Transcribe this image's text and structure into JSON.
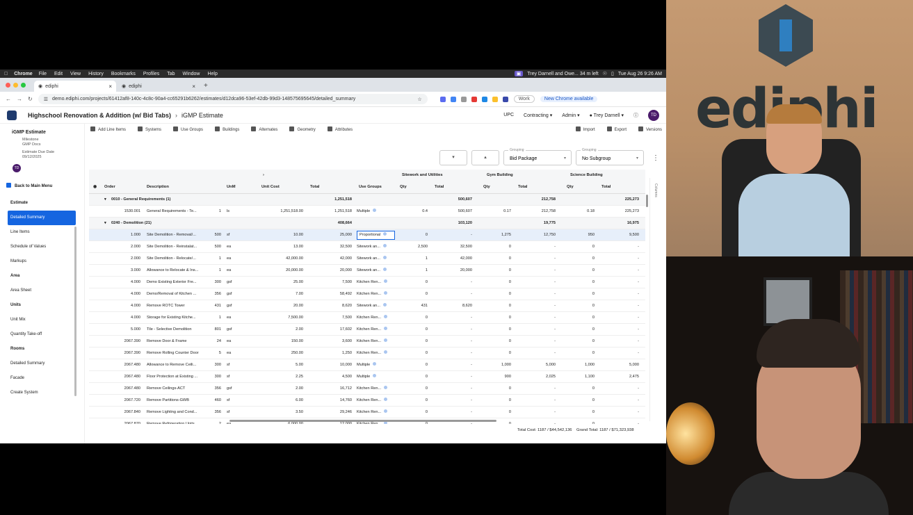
{
  "menubar": {
    "app": "Chrome",
    "items": [
      "File",
      "Edit",
      "View",
      "History",
      "Bookmarks",
      "Profiles",
      "Tab",
      "Window",
      "Help"
    ],
    "meeting": "Trey Darnell and Owe... 34 m left",
    "datetime": "Tue Aug 26 9:26 AM"
  },
  "browser": {
    "tabs": [
      "ediphi",
      "ediphi"
    ],
    "url": "demo.ediphi.com/projects/61412af8-140c-4c8c-90a4-cc65291b6262/estimates/d12dca96-53ef-42db-99d3-148575695645/detailed_summary",
    "work_label": "Work",
    "new_chrome_label": "New Chrome available"
  },
  "app": {
    "project": "Highschool Renovation & Addition (w/ Bid Tabs)",
    "estimate": "iGMP Estimate",
    "nav": [
      "UPC",
      "Contracting",
      "Admin",
      "Trey Darnell"
    ],
    "user_initials": "TD"
  },
  "sidebar": {
    "estimate_name": "iGMP Estimate",
    "milestone_label": "Milestone",
    "milestone_value": "GMP Docs",
    "due_label": "Estimate Due Date",
    "due_value": "09/12/2025",
    "avatar": "TD",
    "back": "Back to Main Menu",
    "items": [
      {
        "label": "Estimate",
        "type": "section"
      },
      {
        "label": "Detailed Summary",
        "type": "active"
      },
      {
        "label": "Line Items",
        "type": "item"
      },
      {
        "label": "Schedule of Values",
        "type": "item"
      },
      {
        "label": "Markups",
        "type": "item"
      },
      {
        "label": "Area",
        "type": "section"
      },
      {
        "label": "Area Sheet",
        "type": "item"
      },
      {
        "label": "Units",
        "type": "section"
      },
      {
        "label": "Unit Mix",
        "type": "item"
      },
      {
        "label": "Quantity Take-off",
        "type": "item"
      },
      {
        "label": "Rooms",
        "type": "section"
      },
      {
        "label": "Detailed Summary",
        "type": "item"
      },
      {
        "label": "Facade",
        "type": "item"
      },
      {
        "label": "Create System",
        "type": "item"
      }
    ]
  },
  "toolbar": {
    "left": [
      "Add Line Items",
      "Systems",
      "Use Groups",
      "Buildings",
      "Alternates",
      "Geometry",
      "Attributes"
    ],
    "right": [
      "Import",
      "Export",
      "Versions"
    ]
  },
  "controls": {
    "grouping_label": "Grouping",
    "grouping_value": "Bid Package",
    "subgroup_label": "Grouping",
    "subgroup_value": "No Subgroup"
  },
  "grid": {
    "group_headers": [
      "Sitework and Utilities",
      "Gym Building",
      "Science Building"
    ],
    "columns": [
      "Order",
      "Description",
      "UnM",
      "Unit Cost",
      "Total",
      "Use Groups",
      "Qty",
      "Total",
      "Qty",
      "Total",
      "Qty",
      "Total"
    ],
    "rows": [
      {
        "kind": "group",
        "order": "0010 - General Requirements (1)",
        "total": "1,251,518",
        "s_total": "500,607",
        "g_total": "212,758",
        "sc_total": "225,273"
      },
      {
        "kind": "row",
        "order": "1530.001",
        "desc": "General Requirements - Te...",
        "q": "1",
        "unm": "ls",
        "uc": "1,251,518.00",
        "total": "1,251,518",
        "ug": "Multiple",
        "sq": "0.4",
        "st": "500,607",
        "gq": "0.17",
        "gt": "212,758",
        "cq": "0.18",
        "ct": "225,273"
      },
      {
        "kind": "group",
        "order": "0240 - Demolition (21)",
        "total": "408,664",
        "s_total": "103,120",
        "g_total": "19,775",
        "sc_total": "16,975"
      },
      {
        "kind": "sel",
        "order": "1.000",
        "desc": "Site Demolition - Removal/...",
        "q": "500",
        "unm": "sf",
        "uc": "10.00",
        "total": "25,000",
        "ug": "Proportional",
        "sq": "0",
        "st": "-",
        "gq": "1,275",
        "gt": "12,750",
        "cq": "950",
        "ct": "9,500"
      },
      {
        "kind": "row",
        "order": "2.000",
        "desc": "Site Demolition - Reinstalat...",
        "q": "500",
        "unm": "ea",
        "uc": "13.00",
        "total": "32,500",
        "ug": "Sitework an...",
        "sq": "2,500",
        "st": "32,500",
        "gq": "0",
        "gt": "-",
        "cq": "0",
        "ct": "-"
      },
      {
        "kind": "row",
        "order": "2.000",
        "desc": "Site Demolition - Relocate/...",
        "q": "1",
        "unm": "ea",
        "uc": "42,000.00",
        "total": "42,000",
        "ug": "Sitework an...",
        "sq": "1",
        "st": "42,000",
        "gq": "0",
        "gt": "-",
        "cq": "0",
        "ct": "-"
      },
      {
        "kind": "row",
        "order": "3.000",
        "desc": "Allowance to Relocate & Ins...",
        "q": "1",
        "unm": "ea",
        "uc": "20,000.00",
        "total": "20,000",
        "ug": "Sitework an...",
        "sq": "1",
        "st": "20,000",
        "gq": "0",
        "gt": "-",
        "cq": "0",
        "ct": "-"
      },
      {
        "kind": "row",
        "order": "4.000",
        "desc": "Demo Existing Exterior Fre...",
        "q": "300",
        "unm": "gsf",
        "uc": "25.00",
        "total": "7,500",
        "ug": "Kitchen Ren...",
        "sq": "0",
        "st": "-",
        "gq": "0",
        "gt": "-",
        "cq": "0",
        "ct": "-"
      },
      {
        "kind": "row",
        "order": "4.000",
        "desc": "Demo/Removal of Kitchen ...",
        "q": "356",
        "unm": "gsf",
        "uc": "7.00",
        "total": "58,492",
        "ug": "Kitchen Ren...",
        "sq": "0",
        "st": "-",
        "gq": "0",
        "gt": "-",
        "cq": "0",
        "ct": "-"
      },
      {
        "kind": "row",
        "order": "4.000",
        "desc": "Remove ROTC Tower",
        "q": "431",
        "unm": "gsf",
        "uc": "20.00",
        "total": "8,620",
        "ug": "Sitework an...",
        "sq": "431",
        "st": "8,620",
        "gq": "0",
        "gt": "-",
        "cq": "0",
        "ct": "-"
      },
      {
        "kind": "row",
        "order": "4.000",
        "desc": "Storage for Existing Kitche...",
        "q": "1",
        "unm": "ea",
        "uc": "7,500.00",
        "total": "7,500",
        "ug": "Kitchen Ren...",
        "sq": "0",
        "st": "-",
        "gq": "0",
        "gt": "-",
        "cq": "0",
        "ct": "-"
      },
      {
        "kind": "row",
        "order": "5.000",
        "desc": "Tile - Selective Demolition",
        "q": "801",
        "unm": "gsf",
        "uc": "2.00",
        "total": "17,602",
        "ug": "Kitchen Ren...",
        "sq": "0",
        "st": "-",
        "gq": "0",
        "gt": "-",
        "cq": "0",
        "ct": "-"
      },
      {
        "kind": "row",
        "order": "2067.390",
        "desc": "Remove Door & Frame",
        "q": "24",
        "unm": "ea",
        "uc": "150.00",
        "total": "3,600",
        "ug": "Kitchen Ren...",
        "sq": "0",
        "st": "-",
        "gq": "0",
        "gt": "-",
        "cq": "0",
        "ct": "-"
      },
      {
        "kind": "row",
        "order": "2067.390",
        "desc": "Remove Rolling Counter Door",
        "q": "5",
        "unm": "ea",
        "uc": "250.00",
        "total": "1,250",
        "ug": "Kitchen Ren...",
        "sq": "0",
        "st": "-",
        "gq": "0",
        "gt": "-",
        "cq": "0",
        "ct": "-"
      },
      {
        "kind": "row",
        "order": "2067.480",
        "desc": "Allowance to Remove Ceili...",
        "q": "300",
        "unm": "sf",
        "uc": "5.00",
        "total": "10,000",
        "ug": "Multiple",
        "sq": "0",
        "st": "-",
        "gq": "1,000",
        "gt": "5,000",
        "cq": "1,000",
        "ct": "5,000"
      },
      {
        "kind": "row",
        "order": "2067.480",
        "desc": "Floor Protection at Existing ...",
        "q": "300",
        "unm": "sf",
        "uc": "2.25",
        "total": "4,500",
        "ug": "Multiple",
        "sq": "0",
        "st": "-",
        "gq": "900",
        "gt": "2,025",
        "cq": "1,100",
        "ct": "2,475"
      },
      {
        "kind": "row",
        "order": "2067.480",
        "desc": "Remove Ceilings-ACT",
        "q": "356",
        "unm": "gsf",
        "uc": "2.00",
        "total": "16,712",
        "ug": "Kitchen Ren...",
        "sq": "0",
        "st": "-",
        "gq": "0",
        "gt": "-",
        "cq": "0",
        "ct": "-"
      },
      {
        "kind": "row",
        "order": "2067.720",
        "desc": "Remove Partitions-GWB",
        "q": "460",
        "unm": "sf",
        "uc": "6.00",
        "total": "14,760",
        "ug": "Kitchen Ren...",
        "sq": "0",
        "st": "-",
        "gq": "0",
        "gt": "-",
        "cq": "0",
        "ct": "-"
      },
      {
        "kind": "row",
        "order": "2067.840",
        "desc": "Remove Lighting and Cond...",
        "q": "356",
        "unm": "sf",
        "uc": "3.50",
        "total": "29,246",
        "ug": "Kitchen Ren...",
        "sq": "0",
        "st": "-",
        "gq": "0",
        "gt": "-",
        "cq": "0",
        "ct": "-"
      },
      {
        "kind": "row",
        "order": "2067.870",
        "desc": "Remove Refrigeration Units",
        "q": "2",
        "unm": "ea",
        "uc": "6,000.00",
        "total": "12,000",
        "ug": "Kitchen Ren...",
        "sq": "0",
        "st": "-",
        "gq": "0",
        "gt": "-",
        "cq": "0",
        "ct": "-"
      }
    ]
  },
  "rail_label": "Columns",
  "footer": {
    "total_cost": "Total Cost: 1187 / $44,542,136",
    "grand_total": "Grand Total: 1187 / $71,323,938"
  },
  "webcam": {
    "brand": "ediphi"
  }
}
